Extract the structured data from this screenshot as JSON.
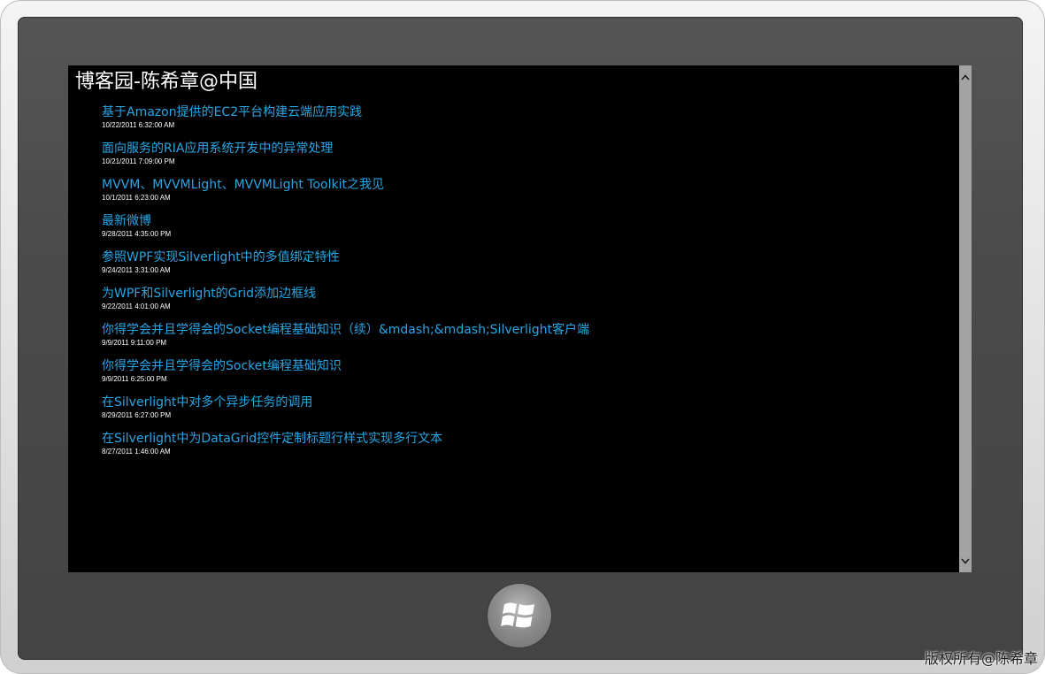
{
  "app": {
    "title": "博客园-陈希章@中国"
  },
  "posts": [
    {
      "title": "基于Amazon提供的EC2平台构建云端应用实践",
      "date": "10/22/2011 6:32:00 AM"
    },
    {
      "title": "面向服务的RIA应用系统开发中的异常处理",
      "date": "10/21/2011 7:09:00 PM"
    },
    {
      "title": "MVVM、MVVMLight、MVVMLight Toolkit之我见",
      "date": "10/1/2011 6:23:00 AM"
    },
    {
      "title": "最新微博",
      "date": "9/28/2011 4:35:00 PM"
    },
    {
      "title": "参照WPF实现Silverlight中的多值绑定特性",
      "date": "9/24/2011 3:31:00 AM"
    },
    {
      "title": "为WPF和Silverlight的Grid添加边框线",
      "date": "9/22/2011 4:01:00 AM"
    },
    {
      "title": "你得学会并且学得会的Socket编程基础知识（续）&mdash;&mdash;Silverlight客户端",
      "date": "9/9/2011 9:11:00 PM"
    },
    {
      "title": "你得学会并且学得会的Socket编程基础知识",
      "date": "9/9/2011 6:25:00 PM"
    },
    {
      "title": "在Silverlight中对多个异步任务的调用",
      "date": "8/29/2011 6:27:00 PM"
    },
    {
      "title": "在Silverlight中为DataGrid控件定制标题行样式实现多行文本",
      "date": "8/27/2011 1:46:00 AM"
    }
  ],
  "scrollbar": {
    "up_icon": "chevron-up-icon",
    "down_icon": "chevron-down-icon"
  },
  "start_button": {
    "icon": "windows-logo-icon"
  },
  "copyright": "版权所有@陈希章",
  "colors": {
    "link": "#27a6e6",
    "screen_background": "#000000",
    "bezel": "#4a4a4a",
    "scrollbar": "#a3a3a3"
  }
}
